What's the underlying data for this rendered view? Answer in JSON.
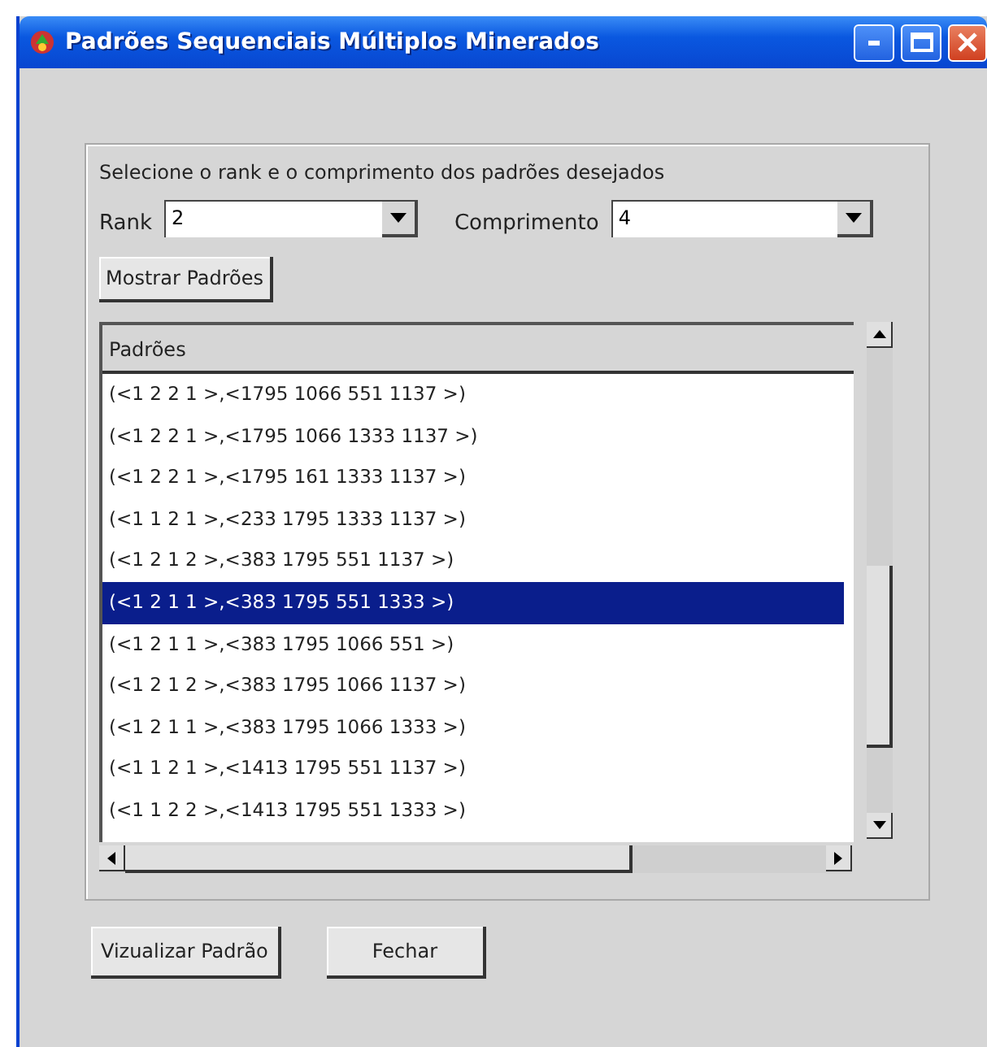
{
  "window": {
    "title": "Padrões Sequenciais Múltiplos Minerados"
  },
  "form": {
    "instruction": "Selecione o rank e o comprimento dos padrões desejados",
    "fields": [
      {
        "label": "Rank",
        "value": "2"
      },
      {
        "label": "Comprimento",
        "value": "4"
      }
    ],
    "show_button": "Mostrar Padrões"
  },
  "list": {
    "column": "Padrões",
    "rows": [
      {
        "text": "(<1 2 2 1 >,<1795 1066 551 1137 >)",
        "selected": false
      },
      {
        "text": "(<1 2 2 1 >,<1795 1066 1333 1137 >)",
        "selected": false
      },
      {
        "text": "(<1 2 2 1 >,<1795 161 1333 1137 >)",
        "selected": false
      },
      {
        "text": "(<1 1 2 1 >,<233 1795 1333 1137 >)",
        "selected": false
      },
      {
        "text": "(<1 2 1 2 >,<383 1795 551 1137 >)",
        "selected": false
      },
      {
        "text": "(<1 2 1 1 >,<383 1795 551 1333 >)",
        "selected": true
      },
      {
        "text": "(<1 2 1 1 >,<383 1795 1066 551 >)",
        "selected": false
      },
      {
        "text": "(<1 2 1 2 >,<383 1795 1066 1137 >)",
        "selected": false
      },
      {
        "text": "(<1 2 1 1 >,<383 1795 1066 1333 >)",
        "selected": false
      },
      {
        "text": "(<1 1 2 1 >,<1413 1795 551 1137 >)",
        "selected": false
      },
      {
        "text": "(<1 1 2 2 >,<1413 1795 551 1333 >)",
        "selected": false
      }
    ]
  },
  "buttons": [
    "Vizualizar Padrão",
    "Fechar"
  ]
}
